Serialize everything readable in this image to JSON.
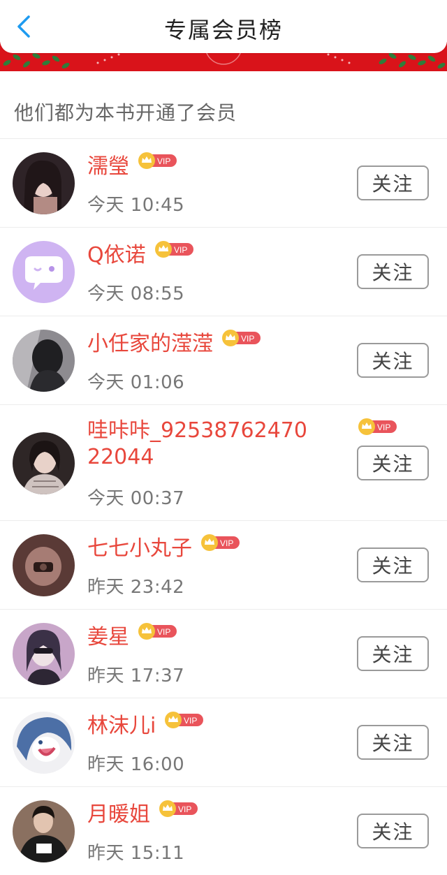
{
  "header": {
    "title": "专属会员榜"
  },
  "section_label": "他们都为本书开通了会员",
  "badge_label": "VIP",
  "follow_label": "关注",
  "members": [
    {
      "name": "濡瑩",
      "time": "今天 10:45",
      "avatar_colors": [
        "#3a2b2e",
        "#c99a93"
      ]
    },
    {
      "name": "Q依诺",
      "time": "今天 08:55",
      "avatar_colors": [
        "#cfb4f2",
        "#ffffff"
      ]
    },
    {
      "name": "小任家的滢滢",
      "time": "今天 01:06",
      "avatar_colors": [
        "#1f1f22",
        "#8d8b90"
      ]
    },
    {
      "name": "哇咔咔_9253876247022044",
      "time": "今天 00:37",
      "avatar_colors": [
        "#2e2626",
        "#d7c9c4"
      ]
    },
    {
      "name": "七七小丸子",
      "time": "昨天 23:42",
      "avatar_colors": [
        "#5a3a36",
        "#a67c74"
      ]
    },
    {
      "name": "姜星",
      "time": "昨天 17:37",
      "avatar_colors": [
        "#3b3147",
        "#c8a6c9"
      ]
    },
    {
      "name": "林沫儿i",
      "time": "昨天 16:00",
      "avatar_colors": [
        "#4c6fa6",
        "#f0f0f3"
      ]
    },
    {
      "name": "月暖姐",
      "time": "昨天 15:11",
      "avatar_colors": [
        "#1b1b1b",
        "#8a7060"
      ]
    }
  ],
  "colors": {
    "name": "#e8473c",
    "vip_badge": "#e9545b",
    "crown": "#f6c23a",
    "banner": "#d9131a",
    "back_arrow": "#1e9bf0"
  }
}
